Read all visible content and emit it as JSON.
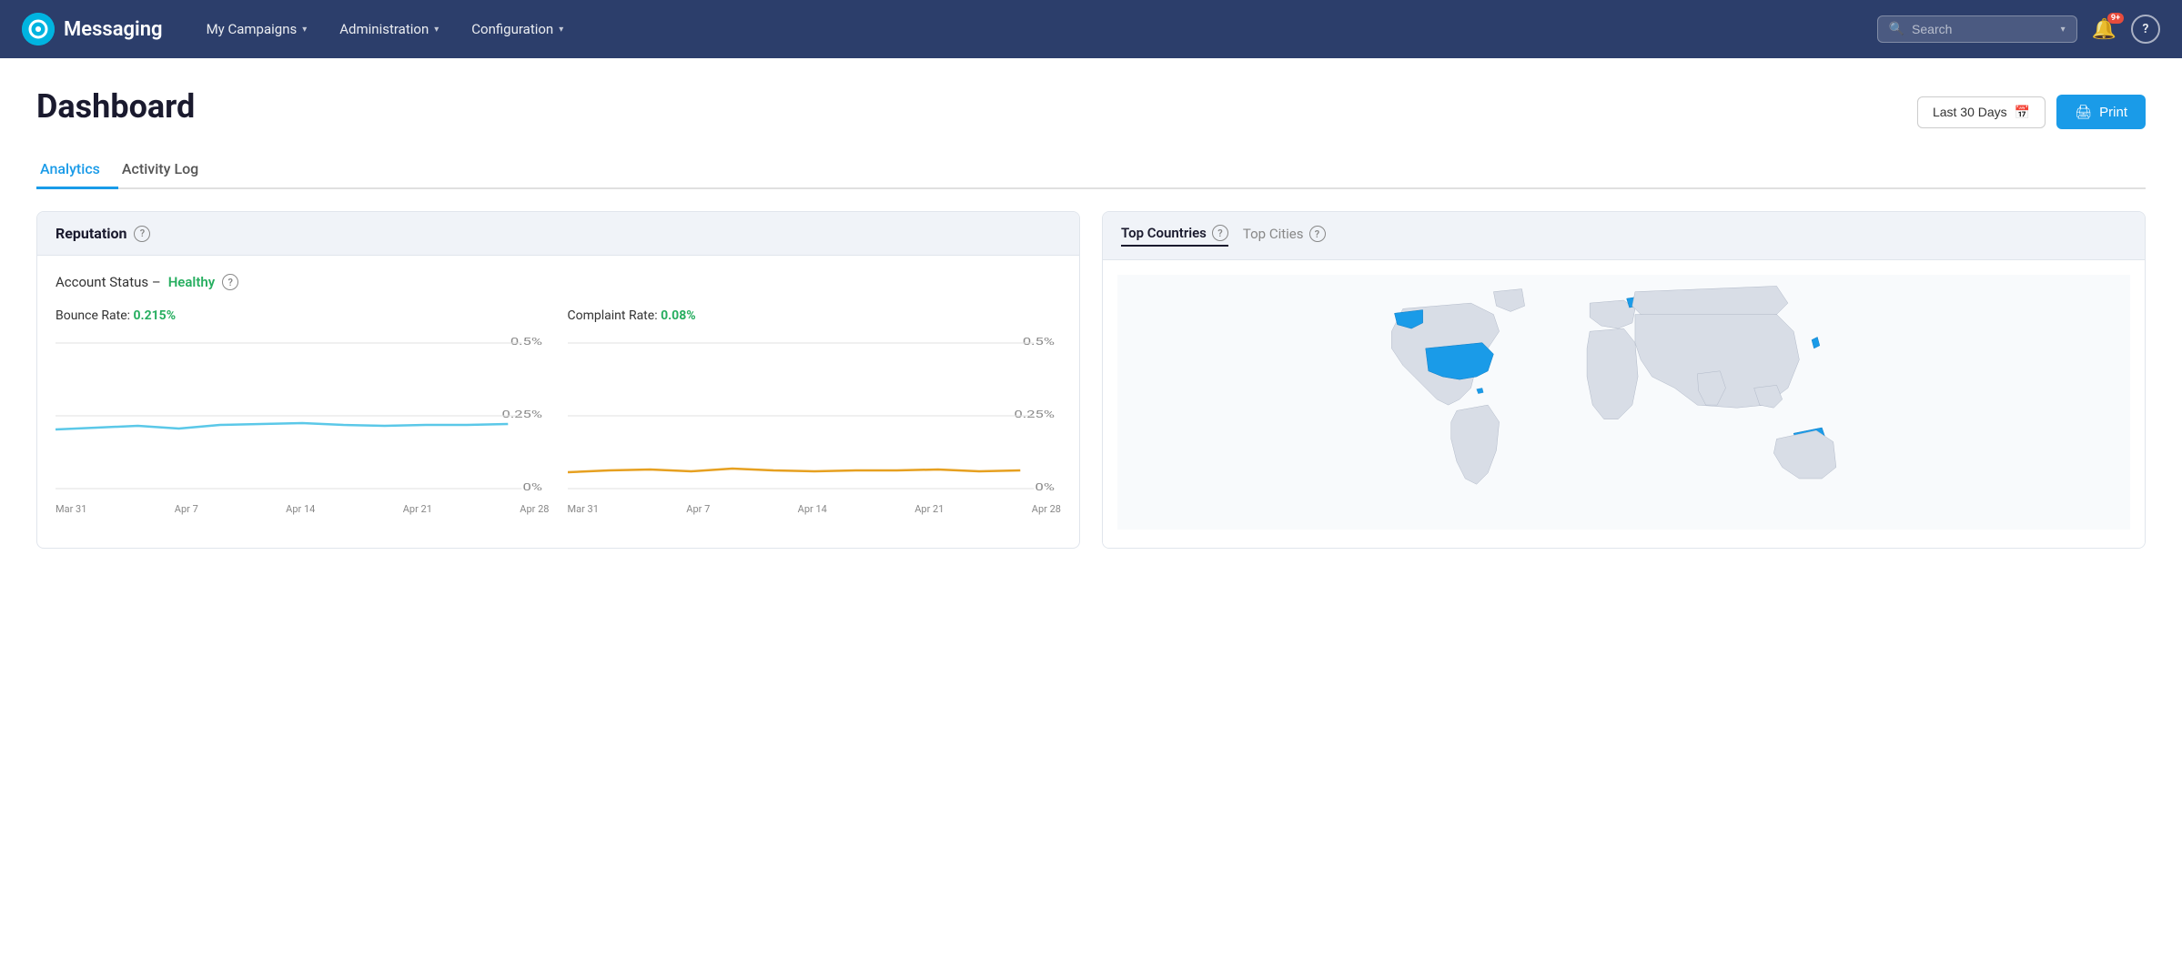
{
  "brand": {
    "name": "Messaging"
  },
  "navbar": {
    "campaigns_label": "My Campaigns",
    "administration_label": "Administration",
    "configuration_label": "Configuration",
    "search_placeholder": "Search",
    "notification_badge": "9+",
    "help_label": "?"
  },
  "page": {
    "title": "Dashboard",
    "date_range_label": "Last 30 Days",
    "print_label": "Print"
  },
  "tabs": [
    {
      "id": "analytics",
      "label": "Analytics",
      "active": true
    },
    {
      "id": "activity-log",
      "label": "Activity Log",
      "active": false
    }
  ],
  "reputation": {
    "title": "Reputation",
    "account_status_label": "Account Status –",
    "account_status_value": "Healthy",
    "bounce_rate_label": "Bounce Rate:",
    "bounce_rate_value": "0.215%",
    "complaint_rate_label": "Complaint Rate:",
    "complaint_rate_value": "0.08%",
    "chart_y_max": "0.5%",
    "chart_y_mid": "0.25%",
    "chart_y_min": "0%",
    "x_labels_bounce": [
      "Mar 31",
      "Apr 7",
      "Apr 14",
      "Apr 21",
      "Apr 28"
    ],
    "x_labels_complaint": [
      "Mar 31",
      "Apr 7",
      "Apr 14",
      "Apr 21",
      "Apr 28"
    ]
  },
  "top_countries": {
    "title": "Top Countries",
    "tab_countries": "Top Countries",
    "tab_cities": "Top Cities"
  }
}
